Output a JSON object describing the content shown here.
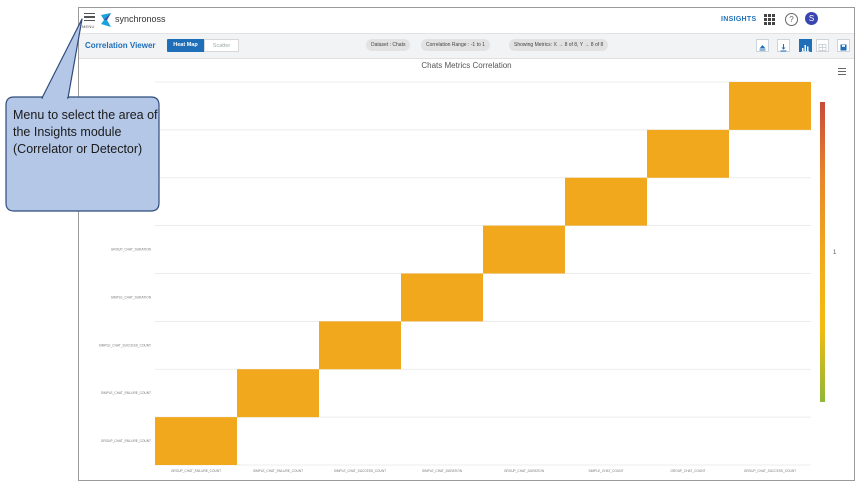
{
  "header": {
    "menu_label": "MENU",
    "brand": "synchronoss",
    "insights_label": "INSIGHTS",
    "avatar_initial": "S",
    "help_glyph": "?"
  },
  "toolbar": {
    "title": "Correlation Viewer",
    "tabs": [
      {
        "label": "Heat Map",
        "active": true
      },
      {
        "label": "Scatter",
        "active": false
      }
    ],
    "dataset": "Dataset : Chats",
    "correlation_range": "Correlation Range : -1  to  1",
    "showing_metrics": "Showing Metrics: X → 8 of 8, Y → 8 of 8",
    "buttons": [
      "eject-icon",
      "download-icon",
      "heatmap-view-icon",
      "table-view-icon",
      "save-icon"
    ]
  },
  "chart_data": {
    "type": "heatmap",
    "title": "Chats Metrics Correlation",
    "x_categories": [
      "GROUP_CHAT_FAILURE_COUNT",
      "SIMPLE_CHAT_FAILURE_COUNT",
      "SIMPLE_CHAT_SUCCESS_COUNT",
      "SIMPLE_CHAT_DURATION",
      "GROUP_CHAT_DURATION",
      "SIMPLE_CHAT_COUNT",
      "GROUP_CHAT_COUNT",
      "GROUP_CHAT_SUCCESS_COUNT"
    ],
    "y_tick_labels_bottom_to_top": [
      "GROUP_CHAT_FAILURE_COUNT",
      "SIMPLE_CHAT_FAILURE_COUNT",
      "SIMPLE_CHAT_SUCCESS_COUNT",
      "SIMPLE_CHAT_DURATION",
      "GROUP_CHAT_DURATION"
    ],
    "cells": [
      {
        "x": 0,
        "y": 0,
        "value": 1
      },
      {
        "x": 1,
        "y": 1,
        "value": 1
      },
      {
        "x": 2,
        "y": 2,
        "value": 1
      },
      {
        "x": 3,
        "y": 3,
        "value": 1
      },
      {
        "x": 4,
        "y": 4,
        "value": 1
      },
      {
        "x": 5,
        "y": 5,
        "value": 1
      },
      {
        "x": 6,
        "y": 6,
        "value": 1
      },
      {
        "x": 7,
        "y": 7,
        "value": 1
      }
    ],
    "colorbar_label": "1",
    "cell_color": "#f2a81d",
    "colorbar_colors": [
      "#c84a3b",
      "#e8862b",
      "#f2a81d",
      "#f4bb10",
      "#8fb73a"
    ],
    "grid": true
  },
  "callout": {
    "text": "Menu to select the area of the Insights module (Correlator or Detector)"
  },
  "colors": {
    "accent": "#1f6fb8",
    "callout_fill": "#b4c7e7",
    "callout_border": "#2f4b7c"
  }
}
